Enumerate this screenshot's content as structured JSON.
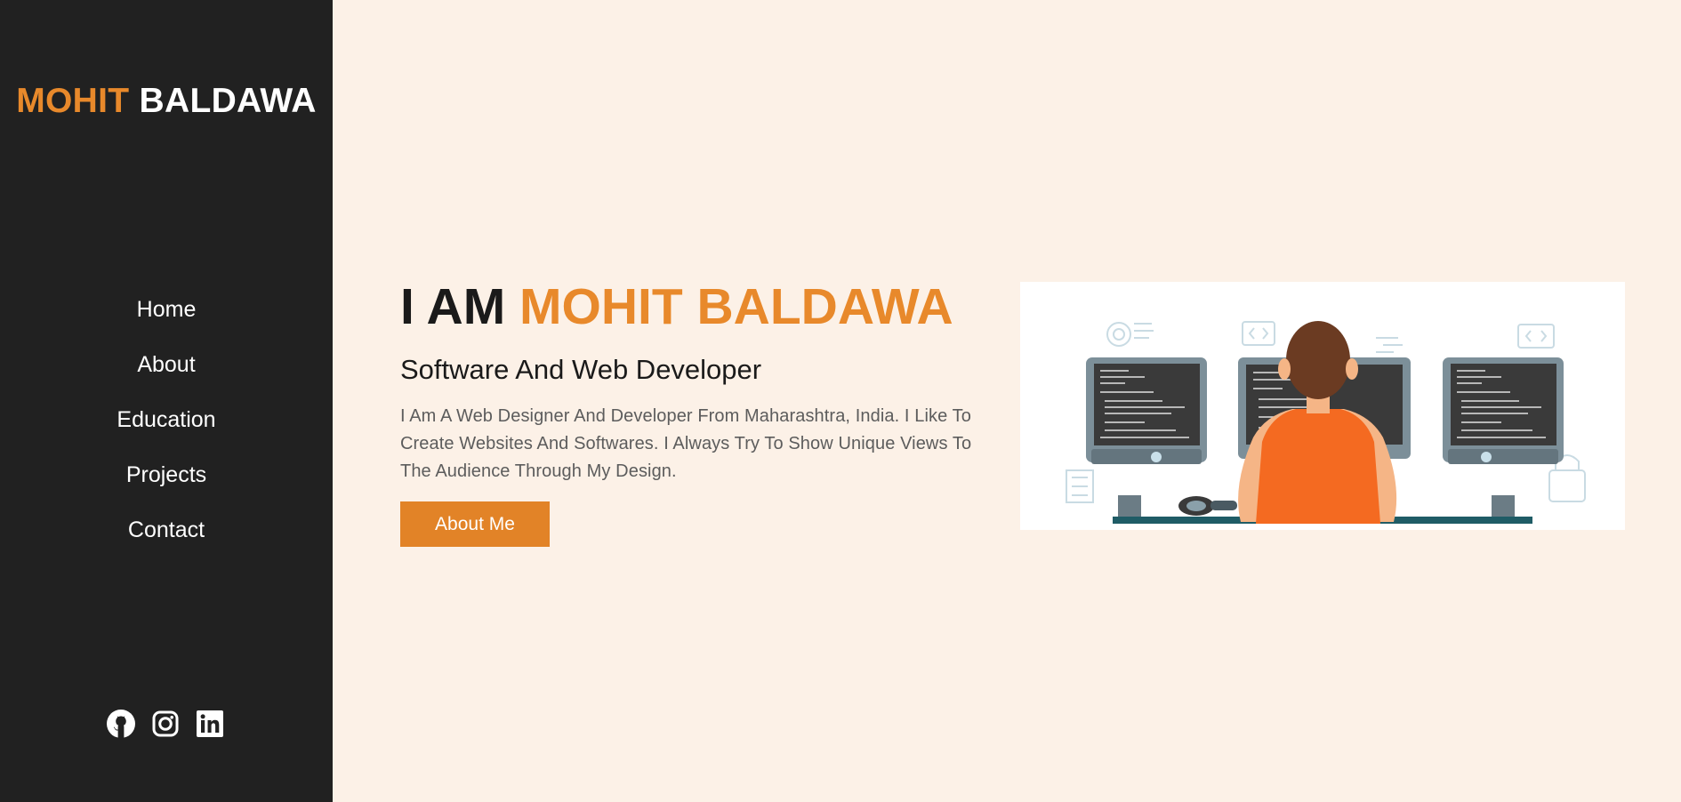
{
  "brand": {
    "first": "MOHIT",
    "last": "BALDAWA"
  },
  "nav": {
    "home": "Home",
    "about": "About",
    "education": "Education",
    "projects": "Projects",
    "contact": "Contact"
  },
  "social": {
    "icons": [
      "github-icon",
      "instagram-icon",
      "linkedin-icon"
    ]
  },
  "hero": {
    "title_prefix": "I AM",
    "title_name": "MOHIT BALDAWA",
    "subtitle": "Software And Web Developer",
    "description": "I Am A Web Designer And Developer From Maharashtra, India. I Like To Create Websites And Softwares. I Always Try To Show Unique Views To The Audience Through My Design.",
    "button_label": "About Me"
  },
  "colors": {
    "accent": "#e8892b",
    "sidebar_bg": "#212121",
    "main_bg": "#fcf1e7"
  }
}
